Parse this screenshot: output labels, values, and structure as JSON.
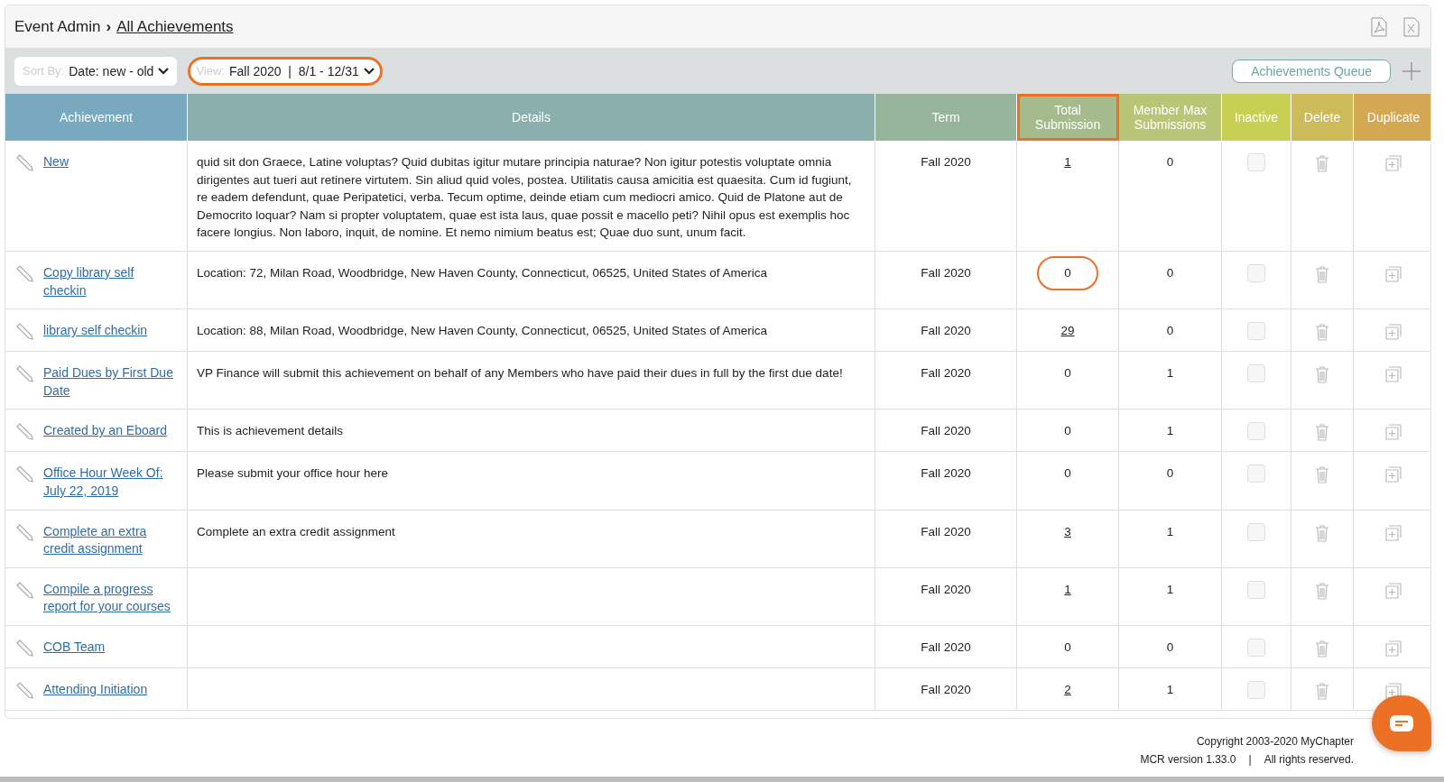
{
  "breadcrumb": {
    "parent": "Event Admin",
    "separator": "›",
    "current": "All Achievements"
  },
  "toolbar": {
    "sort": {
      "label": "Sort By:",
      "value": "Date: new - old",
      "highlighted": false
    },
    "view": {
      "label": "View:",
      "value": "Fall 2020  |  8/1 - 12/31",
      "highlighted": true
    },
    "queue_button": "Achievements Queue"
  },
  "table": {
    "columns": [
      {
        "label": "Achievement",
        "color": "#78a9bf",
        "highlighted": false
      },
      {
        "label": "Details",
        "color": "#8aafac",
        "highlighted": false
      },
      {
        "label": "Term",
        "color": "#97b49d",
        "highlighted": false
      },
      {
        "label": "Total Submission",
        "color": "#a6bb8b",
        "highlighted": true
      },
      {
        "label": "Member Max Submissions",
        "color": "#b9c577",
        "highlighted": false
      },
      {
        "label": "Inactive",
        "color": "#c7d053",
        "highlighted": false
      },
      {
        "label": "Delete",
        "color": "#cdbb59",
        "highlighted": false
      },
      {
        "label": "Duplicate",
        "color": "#d4a853",
        "highlighted": false
      }
    ],
    "rows": [
      {
        "name": "New",
        "details": "quid sit don Graece, Latine voluptas? Quid dubitas igitur mutare principia naturae? Non igitur potestis voluptate omnia dirigentes aut tueri aut retinere virtutem. Sin aliud quid voles, postea. Utilitatis causa amicitia est quaesita. Cum id fugiunt, re eadem defendunt, quae Peripatetici, verba. Tecum optime, deinde etiam cum mediocri amico. Quid de Platone aut de Democrito loquar? Nam si propter voluptatem, quae est ista laus, quae possit e macello peti? Nihil opus est exemplis hoc facere longius. Non laboro, inquit, de nomine. Et nemo nimium beatus est; Quae duo sunt, unum facit.",
        "term": "Fall 2020",
        "total": "1",
        "total_linked": true,
        "total_highlighted": false,
        "max": "0",
        "inactive": false
      },
      {
        "name": "Copy library self checkin",
        "details": "Location: 72, Milan Road, Woodbridge, New Haven County, Connecticut, 06525, United States of America",
        "term": "Fall 2020",
        "total": "0",
        "total_linked": false,
        "total_highlighted": true,
        "max": "0",
        "inactive": false
      },
      {
        "name": "library self checkin",
        "details": "Location: 88, Milan Road, Woodbridge, New Haven County, Connecticut, 06525, United States of America",
        "term": "Fall 2020",
        "total": "29",
        "total_linked": true,
        "total_highlighted": false,
        "max": "0",
        "inactive": false
      },
      {
        "name": "Paid Dues by First Due Date",
        "details": "VP Finance will submit this achievement on behalf of any Members who have paid their dues in full by the first due date!",
        "term": "Fall 2020",
        "total": "0",
        "total_linked": false,
        "total_highlighted": false,
        "max": "1",
        "inactive": false
      },
      {
        "name": "Created by an Eboard",
        "details": "This is achievement details",
        "term": "Fall 2020",
        "total": "0",
        "total_linked": false,
        "total_highlighted": false,
        "max": "1",
        "inactive": false
      },
      {
        "name": "Office Hour Week Of: July 22, 2019",
        "details": "Please submit your office hour here",
        "term": "Fall 2020",
        "total": "0",
        "total_linked": false,
        "total_highlighted": false,
        "max": "0",
        "inactive": false
      },
      {
        "name": "Complete an extra credit assignment",
        "details": "Complete an extra credit assignment",
        "term": "Fall 2020",
        "total": "3",
        "total_linked": true,
        "total_highlighted": false,
        "max": "1",
        "inactive": false
      },
      {
        "name": "Compile a progress report for your courses",
        "term": "Fall 2020",
        "total": "1",
        "total_linked": true,
        "total_highlighted": false,
        "max": "1",
        "inactive": false
      },
      {
        "name": "COB Team",
        "term": "Fall 2020",
        "total": "0",
        "total_linked": false,
        "total_highlighted": false,
        "max": "0",
        "inactive": false
      },
      {
        "name": "Attending Initiation",
        "term": "Fall 2020",
        "total": "2",
        "total_linked": true,
        "total_highlighted": false,
        "max": "1",
        "inactive": false
      }
    ]
  },
  "footer": {
    "copyright": "Copyright 2003-2020 MyChapter",
    "version": "MCR version 1.33.0",
    "divider": "|",
    "rights": "All rights reserved."
  }
}
